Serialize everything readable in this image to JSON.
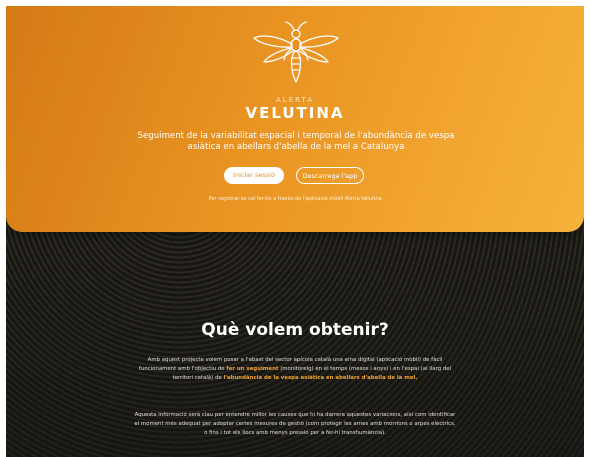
{
  "hero": {
    "brand_small": "ALERTA",
    "brand_big": "VELUTINA",
    "subtitle": "Seguiment de la variabilitat espacial i temporal de l'abundància de vespa asiàtica en abellars d'abella de la mel a Catalunya",
    "login_button": "Iniciar sessió",
    "download_button": "Descarrega l'app",
    "note": "Per registrar-se cal fer-ho a través de l'aplicació mòbil Alerta Velutina"
  },
  "section": {
    "title": "Què volem obtenir?",
    "p1_a": "Amb aquest projecte volem posar a l'abast del sector apícola català una eina digital (aplicació mòbil) de fàcil funcionament amb l'objectiu de ",
    "p1_hl1": "fer un seguiment",
    "p1_b": " (monitoreig) en el temps (mesos i anys) i en l'espai (al llarg del territori català) de ",
    "p1_hl2": "l'abundància de la vespa asiàtica en abellars d'abella de la mel.",
    "p2": "Aquesta informació serà clau per entendre millor les causes que hi ha darrera aquestes variacions, així com identificar el moment més adequat per adoptar certes mesures de gestió (com protegir les arnes amb morrions o arpes elèctrics, o fins i tot els llocs amb menys pressió per a fer-hi transhumància)."
  },
  "colors": {
    "accent": "#f2a530",
    "hero_start": "#d47a16",
    "hero_end": "#f5b23a"
  },
  "icons": {
    "logo": "wasp-icon"
  }
}
